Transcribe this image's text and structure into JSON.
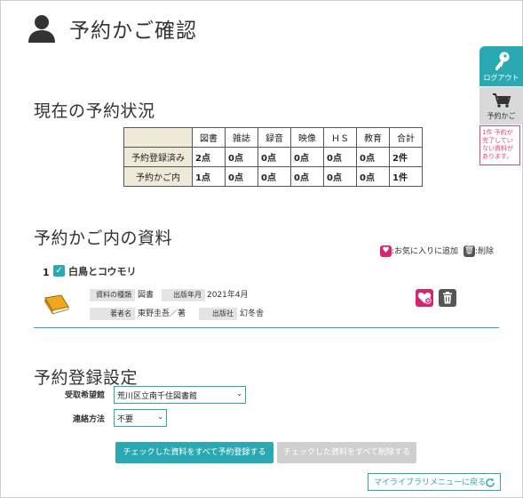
{
  "header": {
    "title": "予約かご確認",
    "icon": "user-icon"
  },
  "side": {
    "login_label": "ログアウト",
    "cart_label": "予約かご",
    "note": "1件 予約が完了していない資料があります。"
  },
  "status": {
    "section_title": "現在の予約状況",
    "columns": [
      "図書",
      "雑誌",
      "録音",
      "映像",
      "ＨＳ",
      "教育",
      "合計"
    ],
    "rows": [
      {
        "label": "予約登録済み",
        "values": [
          "2点",
          "0点",
          "0点",
          "0点",
          "0点",
          "0点",
          "2件"
        ]
      },
      {
        "label": "予約かご内",
        "values": [
          "1点",
          "0点",
          "0点",
          "0点",
          "0点",
          "0点",
          "1件"
        ]
      }
    ]
  },
  "cart": {
    "section_title": "予約かご内の資料",
    "legend_fav": ":お気に入りに追加",
    "legend_del": ":削除",
    "item": {
      "number": "1",
      "title": "白鳥とコウモリ",
      "type_label": "資料の種類",
      "type_value": "図書",
      "year_label": "出版年月",
      "year_value": "2021年4月",
      "author_label": "著者名",
      "author_value": "東野圭吾／著",
      "publisher_label": "出版社",
      "publisher_value": "幻冬舎"
    }
  },
  "settings": {
    "section_title": "予約登録設定",
    "pickup_label": "受取希望館",
    "pickup_value": "荒川区立南千住図書館",
    "contact_label": "連絡方法",
    "contact_value": "不要"
  },
  "actions": {
    "register_all": "チェックした資料をすべて予約登録する",
    "delete_all": "チェックした資料をすべて削除する",
    "back": "マイライブラリメニューに戻る"
  },
  "colors": {
    "accent": "#2aa9b3",
    "fav": "#d6246e",
    "warning": "#e0467c"
  }
}
